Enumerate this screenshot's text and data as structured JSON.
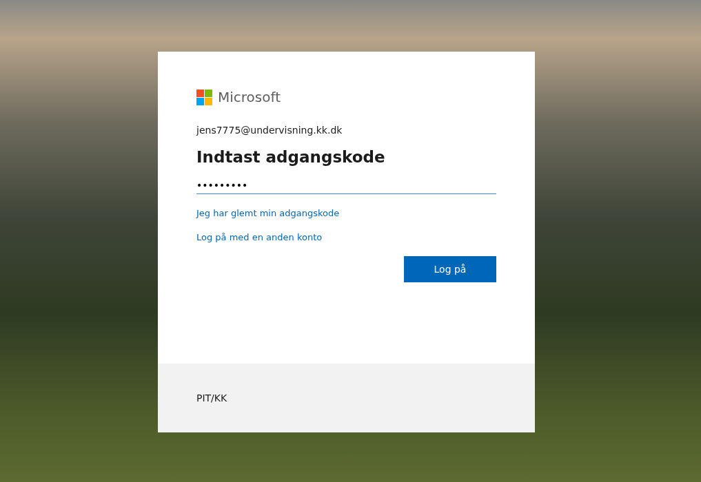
{
  "brand": {
    "name": "Microsoft"
  },
  "account": "jens7775@undervisning.kk.dk",
  "title": "Indtast adgangskode",
  "password_field": {
    "value": "•••••••••"
  },
  "links": [
    "Jeg har glemt min adgangskode",
    "Log på med en anden konto"
  ],
  "sign_in_button": "Log på",
  "footer": "PIT/KK"
}
